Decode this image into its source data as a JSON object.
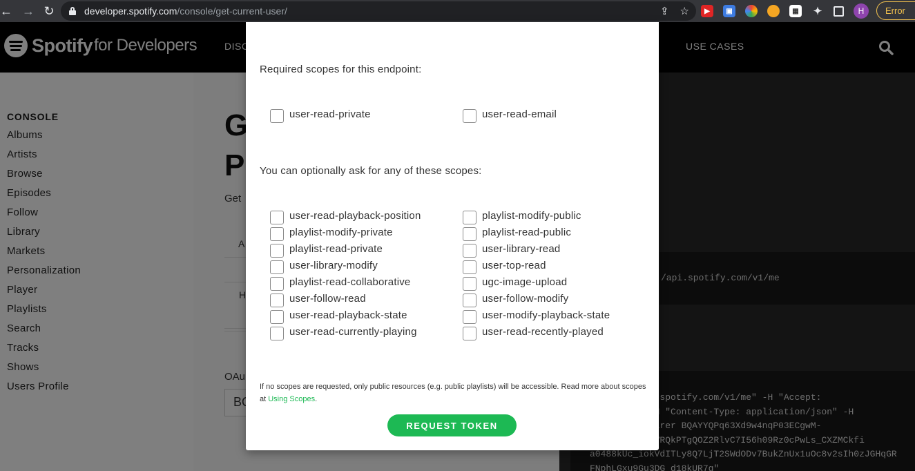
{
  "browser": {
    "url_host": "developer.spotify.com",
    "url_path": "/console/get-current-user/",
    "profile_initial": "H",
    "status_pill": "Error"
  },
  "site": {
    "logo_word": "Spotify",
    "logo_sub": "for Developers",
    "nav_left_partial": "DISC",
    "nav_use_cases": "USE CASES"
  },
  "sidebar": {
    "heading": "CONSOLE",
    "items": [
      "Albums",
      "Artists",
      "Browse",
      "Episodes",
      "Follow",
      "Library",
      "Markets",
      "Personalization",
      "Player",
      "Playlists",
      "Search",
      "Tracks",
      "Shows",
      "Users Profile"
    ]
  },
  "main": {
    "title_partial": "G\nP",
    "desc_partial": "Get",
    "row1_partial": "A",
    "row2_partial": "H",
    "oauth_partial": "OAu",
    "token_partial": "BQ"
  },
  "code": {
    "endpoint_partial": "/api.spotify.com/v1/me",
    "curl_partial": "\"https://api.spotify.com/v1/me\" -H \"Accept:\n      son\" -H \"Content-Type: application/json\" -H\n       n: Bearer BQAYYQPq63Xd9w4nqP03ECgwM-\n       WWDMCVRQkPTgQOZ2RlvC7I56h09Rz0cPwLs_CXZMCkfi\na0488kUc_iokVdITLy8Q7LjT2SWdODv7BukZnUx1uOc8v2sIh0zJGHqGR\nFNphLGxu9Gu3DG_d18kUR7g\""
  },
  "modal": {
    "required_heading": "Required scopes for this endpoint:",
    "required_scopes": [
      "user-read-private",
      "user-read-email"
    ],
    "optional_heading": "You can optionally ask for any of these scopes:",
    "optional_left": [
      "user-read-playback-position",
      "playlist-modify-private",
      "playlist-read-private",
      "user-library-modify",
      "playlist-read-collaborative",
      "user-follow-read",
      "user-read-playback-state",
      "user-read-currently-playing"
    ],
    "optional_right": [
      "playlist-modify-public",
      "playlist-read-public",
      "user-library-read",
      "user-top-read",
      "ugc-image-upload",
      "user-follow-modify",
      "user-modify-playback-state",
      "user-read-recently-played"
    ],
    "footnote_text": "If no scopes are requested, only public resources (e.g. public playlists) will be accessible. Read more about scopes at ",
    "footnote_link": "Using Scopes",
    "footnote_end": ".",
    "request_button": "REQUEST TOKEN"
  },
  "colors": {
    "brand_green": "#1db954",
    "header_black": "#000000",
    "code_bg": "#282828"
  }
}
